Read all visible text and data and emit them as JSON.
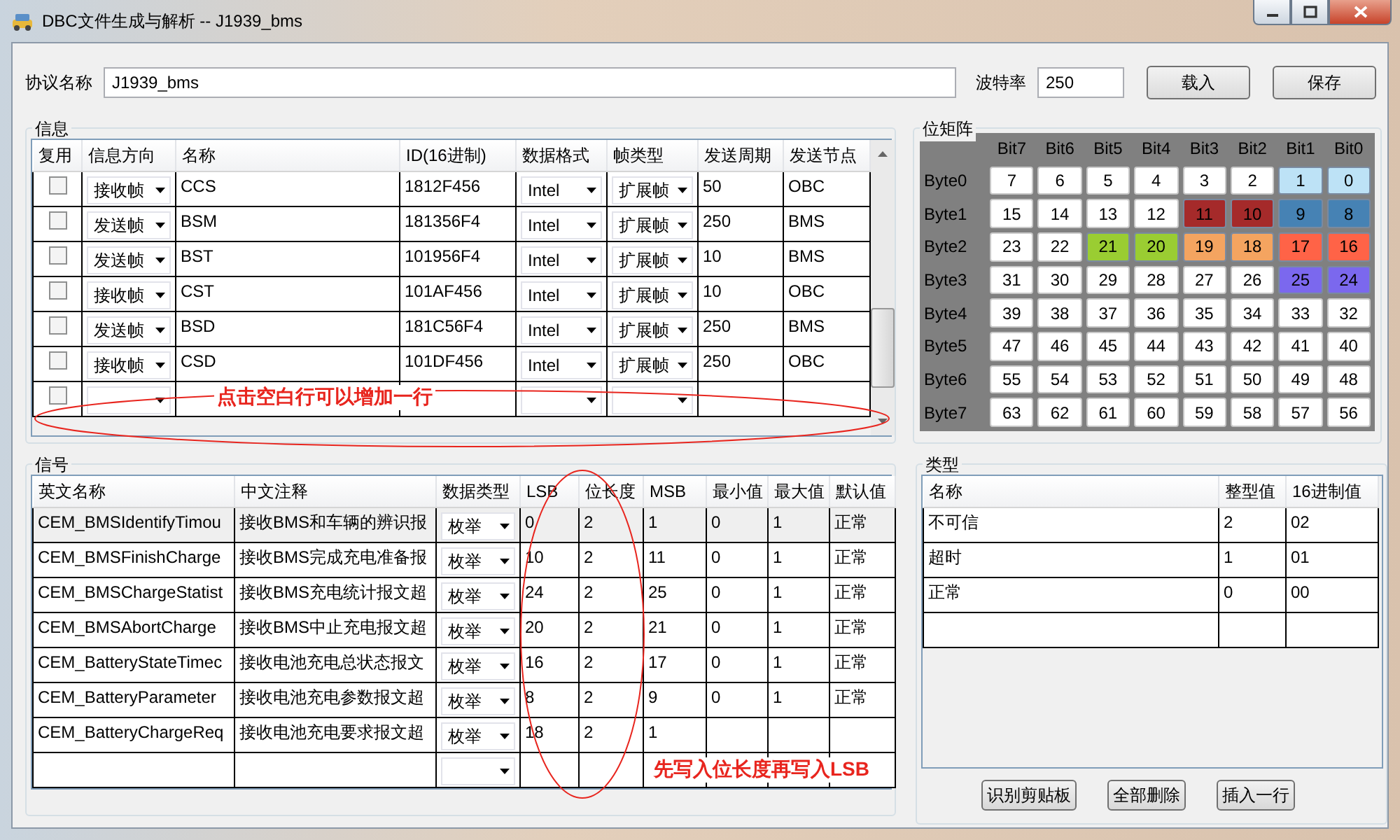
{
  "window": {
    "title": "DBC文件生成与解析 -- J1939_bms"
  },
  "protocol": {
    "label": "协议名称",
    "value": "J1939_bms"
  },
  "baud": {
    "label": "波特率",
    "value": "250"
  },
  "top_buttons": [
    "载入",
    "保存"
  ],
  "info": {
    "title": "信息",
    "columns": [
      "复用",
      "信息方向",
      "名称",
      "ID(16进制)",
      "数据格式",
      "帧类型",
      "发送周期",
      "发送节点"
    ],
    "rows": [
      {
        "reuse": false,
        "direction": "接收帧",
        "name": "CCS",
        "id": "1812F456",
        "format": "Intel",
        "frame": "扩展帧",
        "period": "50",
        "node": "OBC"
      },
      {
        "reuse": false,
        "direction": "发送帧",
        "name": "BSM",
        "id": "181356F4",
        "format": "Intel",
        "frame": "扩展帧",
        "period": "250",
        "node": "BMS"
      },
      {
        "reuse": false,
        "direction": "发送帧",
        "name": "BST",
        "id": "101956F4",
        "format": "Intel",
        "frame": "扩展帧",
        "period": "10",
        "node": "BMS"
      },
      {
        "reuse": false,
        "direction": "接收帧",
        "name": "CST",
        "id": "101AF456",
        "format": "Intel",
        "frame": "扩展帧",
        "period": "10",
        "node": "OBC"
      },
      {
        "reuse": false,
        "direction": "发送帧",
        "name": "BSD",
        "id": "181C56F4",
        "format": "Intel",
        "frame": "扩展帧",
        "period": "250",
        "node": "BMS"
      },
      {
        "reuse": false,
        "direction": "接收帧",
        "name": "CSD",
        "id": "101DF456",
        "format": "Intel",
        "frame": "扩展帧",
        "period": "250",
        "node": "OBC"
      },
      {
        "reuse": false
      }
    ],
    "annotation": {
      "text": "点击空白行可以增加一行"
    }
  },
  "bits": {
    "title": "位矩阵",
    "columns": [
      "Bit7",
      "Bit6",
      "Bit5",
      "Bit4",
      "Bit3",
      "Bit2",
      "Bit1",
      "Bit0"
    ],
    "rows": [
      {
        "label": "Byte0",
        "cells": [
          {
            "label": "7"
          },
          {
            "label": "6"
          },
          {
            "label": "5"
          },
          {
            "label": "4"
          },
          {
            "label": "3"
          },
          {
            "label": "2"
          },
          {
            "label": "1",
            "color": "#bde2f6"
          },
          {
            "label": "0",
            "color": "#bde2f6"
          }
        ]
      },
      {
        "label": "Byte1",
        "cells": [
          {
            "label": "15"
          },
          {
            "label": "14"
          },
          {
            "label": "13"
          },
          {
            "label": "12"
          },
          {
            "label": "11",
            "color": "#a52a2a"
          },
          {
            "label": "10",
            "color": "#a52a2a"
          },
          {
            "label": "9",
            "color": "#4682b4"
          },
          {
            "label": "8",
            "color": "#4682b4"
          }
        ]
      },
      {
        "label": "Byte2",
        "cells": [
          {
            "label": "23"
          },
          {
            "label": "22"
          },
          {
            "label": "21",
            "color": "#9acd32"
          },
          {
            "label": "20",
            "color": "#9acd32"
          },
          {
            "label": "19",
            "color": "#f4a460"
          },
          {
            "label": "18",
            "color": "#f4a460"
          },
          {
            "label": "17",
            "color": "#ff6347"
          },
          {
            "label": "16",
            "color": "#ff6347"
          }
        ]
      },
      {
        "label": "Byte3",
        "cells": [
          {
            "label": "31"
          },
          {
            "label": "30"
          },
          {
            "label": "29"
          },
          {
            "label": "28"
          },
          {
            "label": "27"
          },
          {
            "label": "26"
          },
          {
            "label": "25",
            "color": "#7b68ee"
          },
          {
            "label": "24",
            "color": "#7b68ee"
          }
        ]
      },
      {
        "label": "Byte4",
        "cells": [
          {
            "label": "39"
          },
          {
            "label": "38"
          },
          {
            "label": "37"
          },
          {
            "label": "36"
          },
          {
            "label": "35"
          },
          {
            "label": "34"
          },
          {
            "label": "33"
          },
          {
            "label": "32"
          }
        ]
      },
      {
        "label": "Byte5",
        "cells": [
          {
            "label": "47"
          },
          {
            "label": "46"
          },
          {
            "label": "45"
          },
          {
            "label": "44"
          },
          {
            "label": "43"
          },
          {
            "label": "42"
          },
          {
            "label": "41"
          },
          {
            "label": "40"
          }
        ]
      },
      {
        "label": "Byte6",
        "cells": [
          {
            "label": "55"
          },
          {
            "label": "54"
          },
          {
            "label": "53"
          },
          {
            "label": "52"
          },
          {
            "label": "51"
          },
          {
            "label": "50"
          },
          {
            "label": "49"
          },
          {
            "label": "48"
          }
        ]
      },
      {
        "label": "Byte7",
        "cells": [
          {
            "label": "63"
          },
          {
            "label": "62"
          },
          {
            "label": "61"
          },
          {
            "label": "60"
          },
          {
            "label": "59"
          },
          {
            "label": "58"
          },
          {
            "label": "57"
          },
          {
            "label": "56"
          }
        ]
      }
    ]
  },
  "signals": {
    "title": "信号",
    "columns": [
      "英文名称",
      "中文注释",
      "数据类型",
      "LSB",
      "位长度",
      "MSB",
      "最小值",
      "最大值",
      "默认值"
    ],
    "rows": [
      {
        "selected": true,
        "en": "CEM_BMSIdentifyTimou",
        "cn": "接收BMS和车辆的辨识报",
        "type": "枚举",
        "lsb": "0",
        "len": "2",
        "msb": "1",
        "min": "0",
        "max": "1",
        "def": "正常"
      },
      {
        "selected": false,
        "en": "CEM_BMSFinishCharge",
        "cn": "接收BMS完成充电准备报",
        "type": "枚举",
        "lsb": "10",
        "len": "2",
        "msb": "11",
        "min": "0",
        "max": "1",
        "def": "正常"
      },
      {
        "selected": false,
        "en": "CEM_BMSChargeStatist",
        "cn": "接收BMS充电统计报文超",
        "type": "枚举",
        "lsb": "24",
        "len": "2",
        "msb": "25",
        "min": "0",
        "max": "1",
        "def": "正常"
      },
      {
        "selected": false,
        "en": "CEM_BMSAbortCharge",
        "cn": "接收BMS中止充电报文超",
        "type": "枚举",
        "lsb": "20",
        "len": "2",
        "msb": "21",
        "min": "0",
        "max": "1",
        "def": "正常"
      },
      {
        "selected": false,
        "en": "CEM_BatteryStateTimec",
        "cn": "接收电池充电总状态报文",
        "type": "枚举",
        "lsb": "16",
        "len": "2",
        "msb": "17",
        "min": "0",
        "max": "1",
        "def": "正常"
      },
      {
        "selected": false,
        "en": "CEM_BatteryParameter",
        "cn": "接收电池充电参数报文超",
        "type": "枚举",
        "lsb": "8",
        "len": "2",
        "msb": "9",
        "min": "0",
        "max": "1",
        "def": "正常"
      },
      {
        "selected": false,
        "en": "CEM_BatteryChargeReq",
        "cn": "接收电池充电要求报文超",
        "type": "枚举",
        "lsb": "18",
        "len": "2",
        "msb": "1"
      },
      {
        "selected": false
      }
    ],
    "annotation": {
      "text": "先写入位长度再写入LSB"
    }
  },
  "types": {
    "title": "类型",
    "columns": [
      "名称",
      "整型值",
      "16进制值"
    ],
    "rows": [
      {
        "name": "不可信",
        "int": "2",
        "hex": "02"
      },
      {
        "name": "超时",
        "int": "1",
        "hex": "01"
      },
      {
        "name": "正常",
        "int": "0",
        "hex": "00"
      },
      {}
    ],
    "buttons": [
      "识别剪贴板",
      "全部删除",
      "插入一行"
    ]
  }
}
